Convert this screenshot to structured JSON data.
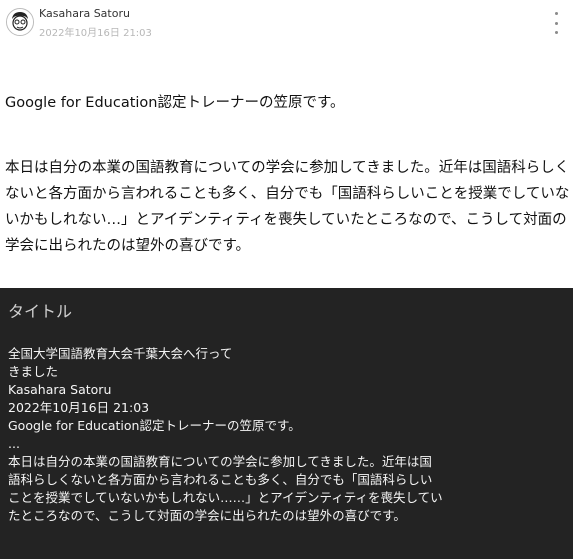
{
  "post": {
    "author": "Kasahara Satoru",
    "date": "2022年10月16日 21:03",
    "paragraph1": "Google for Education認定トレーナーの笠原です。",
    "paragraph2": "本日は自分の本業の国語教育についての学会に参加してきました。近年は国語科らしくないと各方面から言われることも多く、自分でも「国語科らしいことを授業でしていないかもしれない…」とアイデンティティを喪失していたところなので、こうして対面の学会に出られたのは望外の喜びです。",
    "menu_icon": "more-vertical-icon"
  },
  "card": {
    "title": "タイトル",
    "body": "全国大学国語教育大会千葉大会へ行って\nきました\nKasahara Satoru\n2022年10月16日 21:03\nGoogle for Education認定トレーナーの笠原です。\n...\n本日は自分の本業の国語教育についての学会に参加してきました。近年は国\n語科らしくないと各方面から言われることも多く、自分でも「国語科らしい\nことを授業でしていないかもしれない……」とアイデンティティを喪失してい\nたところなので、こうして対面の学会に出られたのは望外の喜びです。"
  }
}
